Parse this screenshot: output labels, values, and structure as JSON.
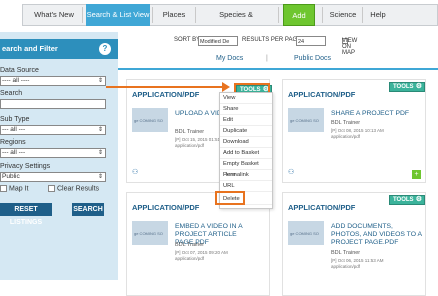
{
  "nav": {
    "items": [
      "What's New",
      "Search & List View",
      "Places",
      "Species & Environment",
      "Add New",
      "Science",
      "Help"
    ]
  },
  "sidebar": {
    "title": "earch and Filter",
    "help": "?",
    "data_source_label": "Data Source",
    "data_source_value": "---- all ----",
    "search_label": "Search",
    "sub_type_label": "Sub Type",
    "sub_type_value": "--- all ---",
    "regions_label": "Regions",
    "regions_value": "--- all ---",
    "privacy_label": "Privacy Settings",
    "privacy_value": "Public",
    "map_it_label": "Map It",
    "clear_results_label": "Clear Results",
    "reset_button": "RESET LISTINGS",
    "search_button": "SEARCH"
  },
  "sortbar": {
    "sort_by_label": "SORT BY",
    "sort_by_value": "Modified De",
    "results_label": "RESULTS PER PAGE",
    "results_value": "24",
    "view_on_map_label": "VIEW ON MAP"
  },
  "tabs": {
    "my_docs": "My Docs",
    "public_docs": "Public Docs",
    "sep": "|"
  },
  "cards": [
    {
      "type": "APPLICATION/PDF",
      "title": "UPLOAD A VIDEO",
      "author": "BDL Trainer",
      "date": "[P] Oct 15, 2015 01:51 PM",
      "mime": "application/pdf",
      "thumb_text": "ge COMING SO"
    },
    {
      "type": "APPLICATION/PDF",
      "title": "SHARE A PROJECT PDF",
      "author": "BDL Trainer",
      "date": "[P] Oct 08, 2015 10:13 AM",
      "mime": "application/pdf",
      "thumb_text": "ge COMING SO"
    },
    {
      "type": "APPLICATION/PDF",
      "title": "EMBED A VIDEO IN A PROJECT ARTICLE PAGE.PDF",
      "author": "BDL Trainer",
      "date": "[P] Oct 07, 2015 09:20 AM",
      "mime": "application/pdf",
      "thumb_text": "ge COMING SO"
    },
    {
      "type": "APPLICATION/PDF",
      "title": "ADD DOCUMENTS, PHOTOS, AND VIDEOS TO A PROJECT PAGE.PDF",
      "author": "BDL Trainer",
      "date": "[P] Oct 06, 2015 11:53 AM",
      "mime": "application/pdf",
      "thumb_text": "ge COMING SO"
    }
  ],
  "tools_label": "TOOLS",
  "dropdown": [
    "View",
    "Share",
    "Edit",
    "Duplicate",
    "Download",
    "Add to Basket",
    "Empty Basket Here",
    "Permalink",
    "URL",
    "Delete"
  ],
  "colors": {
    "accent": "#3fa7d6",
    "tools_green": "#3bb39b",
    "highlight": "#e8731f",
    "add_new_green": "#6ec62f",
    "sidebar_bg": "#d5e8f3"
  }
}
